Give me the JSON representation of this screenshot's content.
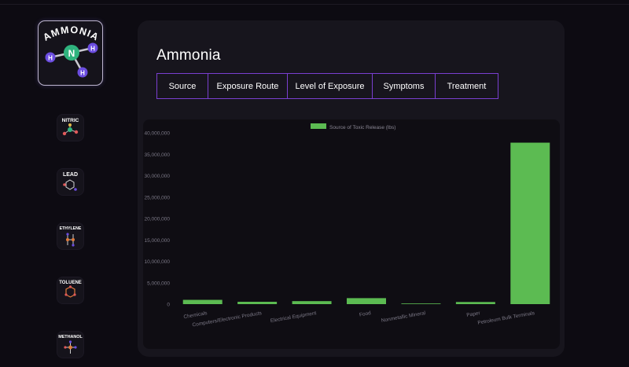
{
  "sidebar": {
    "logo": {
      "label": "AMMONIA",
      "center_atom": "N",
      "side_atom": "H"
    },
    "items": [
      {
        "name": "nitric-acid",
        "label": "NITRIC"
      },
      {
        "name": "lead",
        "label": "LEAD"
      },
      {
        "name": "ethylene-glycol",
        "label": "ETHYLENE"
      },
      {
        "name": "toluene",
        "label": "TOLUENE"
      },
      {
        "name": "methanol",
        "label": "METHANOL"
      }
    ]
  },
  "main": {
    "title": "Ammonia",
    "tabs": [
      "Source",
      "Exposure Route",
      "Level of Exposure",
      "Symptoms",
      "Treatment"
    ]
  },
  "colors": {
    "bar": "#5cbb52",
    "tab_border": "#7a3fd0",
    "panel": "#17151d"
  },
  "chart_data": {
    "type": "bar",
    "categories": [
      "Chemicals",
      "Computers/Electronic Products",
      "Electrical Equipment",
      "Food",
      "Nonmetallic Mineral",
      "Paper",
      "Petroleum Bulk Terminals"
    ],
    "series": [
      {
        "name": "Source of Toxic Release (lbs)",
        "values": [
          1000000,
          550000,
          700000,
          1400000,
          150000,
          500000,
          37700000
        ]
      }
    ],
    "ylim": [
      0,
      40000000
    ],
    "yticks": [
      "0",
      "5,000,000",
      "10,000,000",
      "15,000,000",
      "20,000,000",
      "25,000,000",
      "30,000,000",
      "35,000,000",
      "40,000,000"
    ],
    "legend": "top-center",
    "grid": false
  }
}
